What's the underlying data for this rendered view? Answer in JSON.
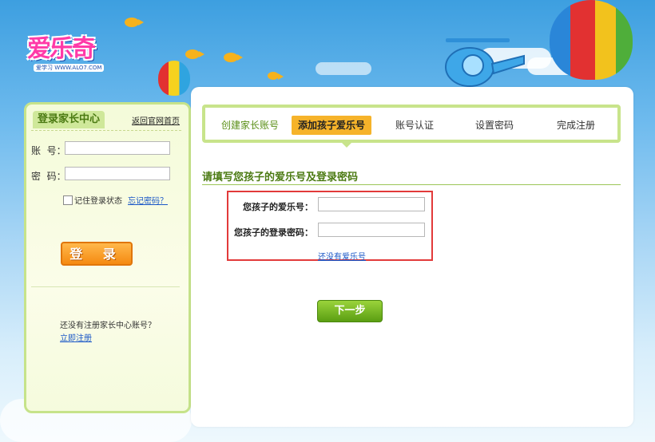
{
  "logo": {
    "text": "爱乐奇",
    "subtitle": "爱学习 WWW.ALO7.COM"
  },
  "login": {
    "title": "登录家长中心",
    "back_link": "返回官网首页",
    "account_label": "账  号：",
    "password_label": "密  码：",
    "account_value": "",
    "password_value": "",
    "remember_label": "记住登录状态",
    "forgot_link": "忘记密码？",
    "login_button": "登  录",
    "no_account_text": "还没有注册家长中心账号？",
    "register_link": "立即注册"
  },
  "steps": [
    {
      "label": "创建家长账号",
      "state": "done"
    },
    {
      "label": "添加孩子爱乐号",
      "state": "active"
    },
    {
      "label": "账号认证",
      "state": "pending"
    },
    {
      "label": "设置密码",
      "state": "pending"
    },
    {
      "label": "完成注册",
      "state": "pending"
    }
  ],
  "form": {
    "section_title": "请填写您孩子的爱乐号及登录密码",
    "child_id_label": "您孩子的爱乐号：",
    "child_password_label": "您孩子的登录密码：",
    "child_id_value": "",
    "child_password_value": "",
    "no_account_link": "还没有爱乐号",
    "next_button": "下一步"
  },
  "colors": {
    "accent_green": "#4b7a12",
    "panel_border": "#c8e48b",
    "active_step": "#f6b32a",
    "login_button": "#f58a11",
    "highlight_border": "#e23a3a",
    "link": "#1a57c7"
  }
}
